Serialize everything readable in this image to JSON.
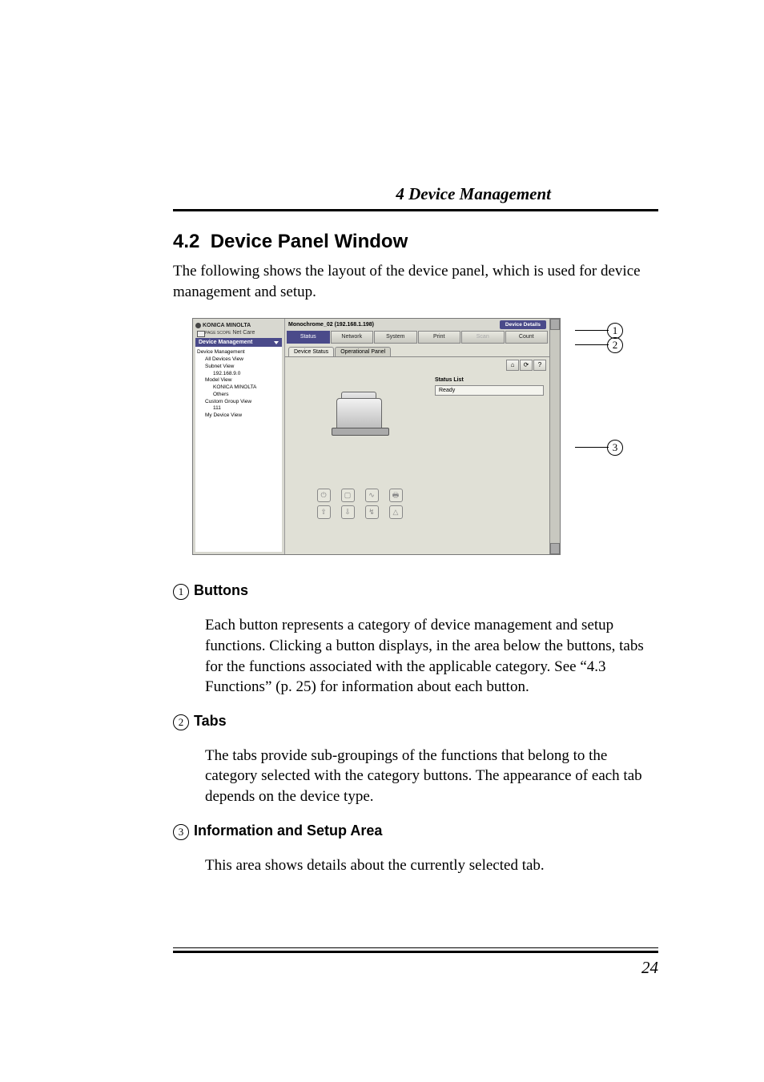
{
  "header": {
    "chapter": "4  Device Management"
  },
  "section": {
    "number": "4.2",
    "title": "Device Panel Window",
    "intro": "The following shows the layout of the device panel, which is used for device management and setup."
  },
  "screenshot": {
    "brand": "KONICA MINOLTA",
    "app_label": "Net Care",
    "app_sub": "PAGE SCOPE",
    "nav_select": "Device Management",
    "tree": [
      "Device Management",
      "All Devices View",
      "Subnet View",
      "192.168.9.0",
      "Model View",
      "KONICA MINOLTA",
      "Others",
      "Custom Group View",
      "111",
      "My Device View"
    ],
    "device_title": "Monochrome_02 (192.168.1.198)",
    "device_button_label": "Device Details",
    "categories": [
      "Status",
      "Network",
      "System",
      "Print",
      "Scan",
      "Count"
    ],
    "active_category_index": 0,
    "tabs": [
      "Device Status",
      "Operational Panel"
    ],
    "active_tab_index": 0,
    "status_head": "Status List",
    "status_value": "Ready"
  },
  "callouts": {
    "c1": "1",
    "c2": "2",
    "c3": "3"
  },
  "items": {
    "buttons_head": "Buttons",
    "buttons_body": "Each button represents a category of device management and setup functions. Clicking a button displays, in the area below the buttons, tabs for the functions associated with the applicable category. See “4.3 Functions” (p. 25) for information about each button.",
    "tabs_head": "Tabs",
    "tabs_body": "The tabs provide sub-groupings of the functions that belong to the category selected with the category buttons. The appearance of each tab depends on the device type.",
    "info_head": "Information and Setup Area",
    "info_body": "This area shows details about the currently selected tab."
  },
  "page_number": "24"
}
